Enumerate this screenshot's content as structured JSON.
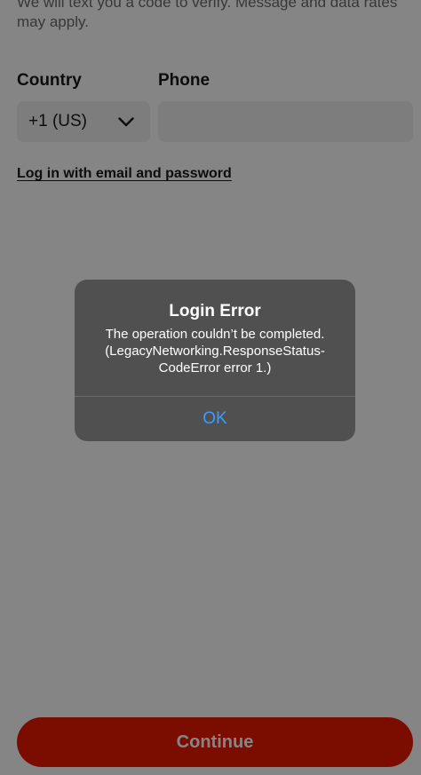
{
  "form": {
    "subtitle": "We will text you a code to verify. Message and data rates may apply.",
    "country_label": "Country",
    "phone_label": "Phone",
    "country_value": "+1 (US)",
    "phone_value": "",
    "email_login_link": "Log in with email and password",
    "continue_label": "Continue"
  },
  "alert": {
    "title": "Login Error",
    "message": "The operation couldn’t be completed. (LegacyNetworking.ResponseStatus-CodeError error 1.)",
    "ok_label": "OK"
  },
  "colors": {
    "brand_red": "#eb1700",
    "alert_link_blue": "#3d9bff"
  }
}
